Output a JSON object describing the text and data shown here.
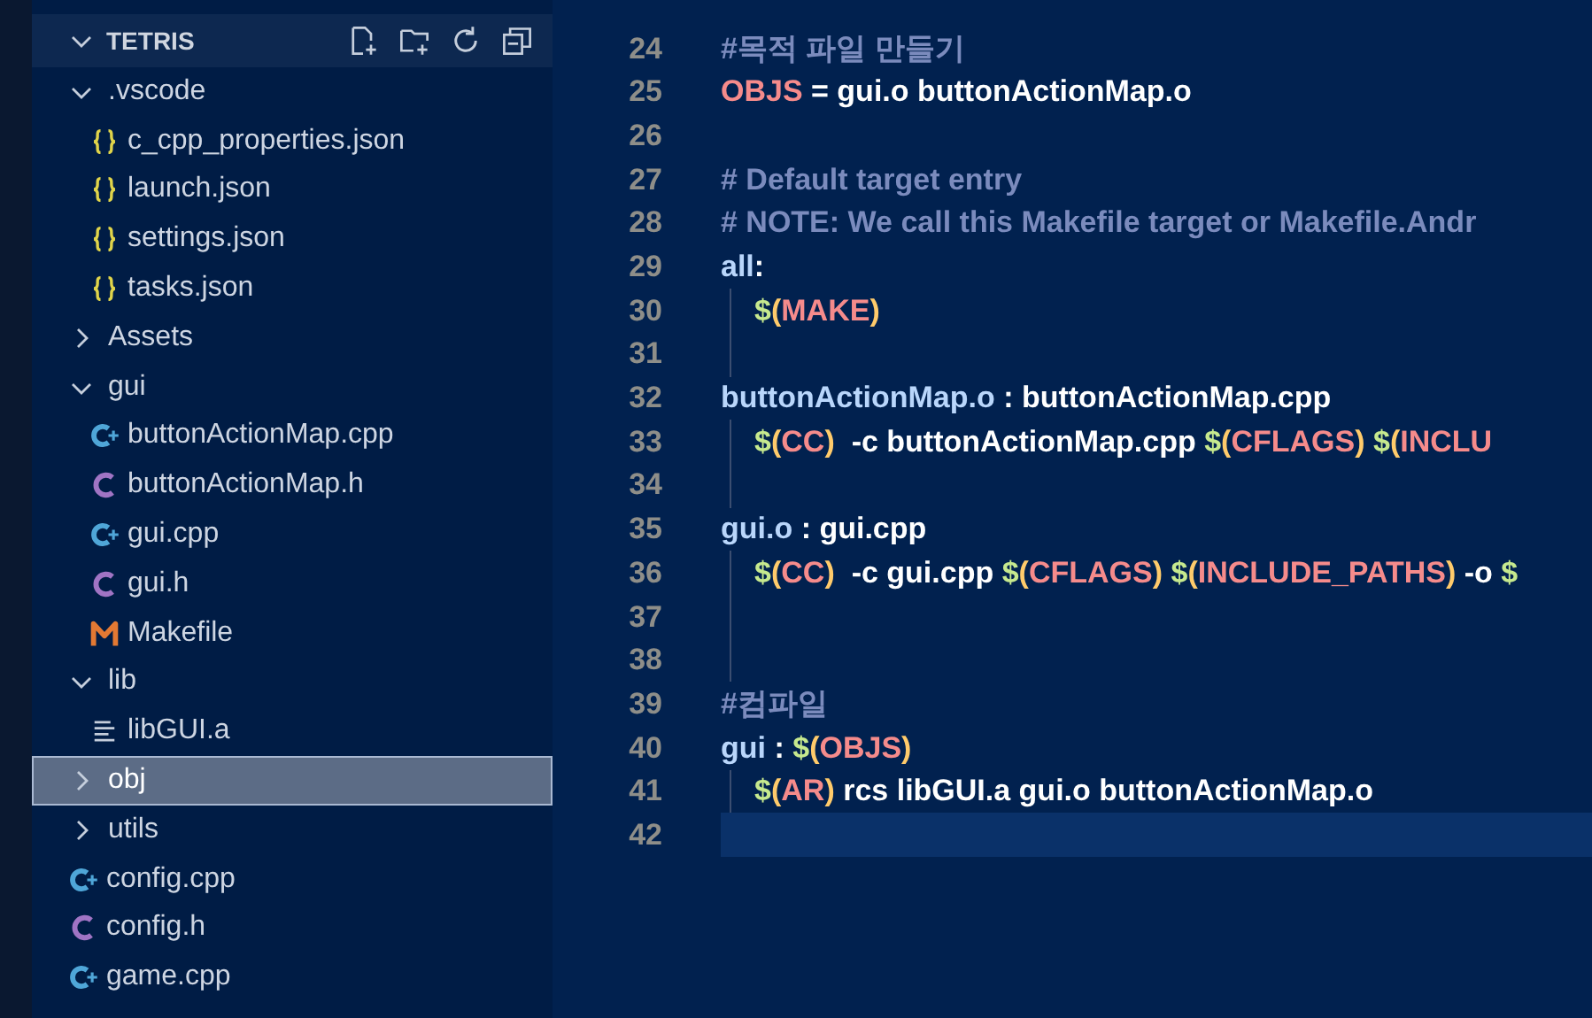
{
  "explorer": {
    "title": "TETRIS",
    "expanded": true,
    "tree": [
      {
        "label": ".vscode",
        "kind": "folder",
        "expanded": true,
        "selected": false,
        "children": [
          {
            "label": "c_cpp_properties.json",
            "kind": "json",
            "selected": false
          },
          {
            "label": "launch.json",
            "kind": "json",
            "selected": false
          },
          {
            "label": "settings.json",
            "kind": "json",
            "selected": false
          },
          {
            "label": "tasks.json",
            "kind": "json",
            "selected": false
          }
        ]
      },
      {
        "label": "Assets",
        "kind": "folder",
        "expanded": false,
        "selected": false
      },
      {
        "label": "gui",
        "kind": "folder",
        "expanded": true,
        "selected": false,
        "children": [
          {
            "label": "buttonActionMap.cpp",
            "kind": "cpp",
            "selected": false
          },
          {
            "label": "buttonActionMap.h",
            "kind": "header",
            "selected": false
          },
          {
            "label": "gui.cpp",
            "kind": "cpp",
            "selected": false
          },
          {
            "label": "gui.h",
            "kind": "header",
            "selected": false
          },
          {
            "label": "Makefile",
            "kind": "makefile",
            "selected": false
          }
        ]
      },
      {
        "label": "lib",
        "kind": "folder",
        "expanded": true,
        "selected": false,
        "children": [
          {
            "label": "libGUI.a",
            "kind": "binary",
            "selected": false
          }
        ]
      },
      {
        "label": "obj",
        "kind": "folder",
        "expanded": false,
        "selected": true
      },
      {
        "label": "utils",
        "kind": "folder",
        "expanded": false,
        "selected": false
      },
      {
        "label": "config.cpp",
        "kind": "cpp",
        "selected": false
      },
      {
        "label": "config.h",
        "kind": "header",
        "selected": false
      },
      {
        "label": "game.cpp",
        "kind": "cpp",
        "selected": false
      }
    ]
  },
  "editor": {
    "lines": [
      {
        "number": "24",
        "indented": false,
        "current": false,
        "tokens": [
          {
            "kind": "comment",
            "text": "#목적 파일 만들기"
          }
        ]
      },
      {
        "number": "25",
        "indented": false,
        "current": false,
        "tokens": [
          {
            "kind": "var",
            "text": "OBJS"
          },
          {
            "kind": "plain",
            "text": " = gui.o buttonActionMap.o"
          }
        ]
      },
      {
        "number": "26",
        "indented": false,
        "current": false
      },
      {
        "number": "27",
        "indented": false,
        "current": false,
        "tokens": [
          {
            "kind": "comment",
            "text": "# Default target entry"
          }
        ]
      },
      {
        "number": "28",
        "indented": false,
        "current": false,
        "tokens": [
          {
            "kind": "comment",
            "text": "# NOTE: We call this Makefile target or Makefile.Andr"
          }
        ]
      },
      {
        "number": "29",
        "indented": false,
        "current": false,
        "tokens": [
          {
            "kind": "target",
            "text": "all"
          },
          {
            "kind": "plain",
            "text": ":"
          }
        ]
      },
      {
        "number": "30",
        "indented": true,
        "current": false,
        "tokens": [
          {
            "kind": "dollar",
            "text": "$"
          },
          {
            "kind": "paren",
            "text": "("
          },
          {
            "kind": "var",
            "text": "MAKE"
          },
          {
            "kind": "paren",
            "text": ")"
          }
        ]
      },
      {
        "number": "31",
        "indented": true,
        "current": false
      },
      {
        "number": "32",
        "indented": false,
        "current": false,
        "tokens": [
          {
            "kind": "target",
            "text": "buttonActionMap.o"
          },
          {
            "kind": "plain",
            "text": " : buttonActionMap.cpp"
          }
        ]
      },
      {
        "number": "33",
        "indented": true,
        "current": false,
        "tokens": [
          {
            "kind": "dollar",
            "text": "$"
          },
          {
            "kind": "paren",
            "text": "("
          },
          {
            "kind": "var",
            "text": "CC"
          },
          {
            "kind": "paren",
            "text": ")"
          },
          {
            "kind": "plain",
            "text": "  -c buttonActionMap.cpp "
          },
          {
            "kind": "dollar",
            "text": "$"
          },
          {
            "kind": "paren",
            "text": "("
          },
          {
            "kind": "var",
            "text": "CFLAGS"
          },
          {
            "kind": "paren",
            "text": ")"
          },
          {
            "kind": "dollar",
            "text": " $"
          },
          {
            "kind": "paren",
            "text": "("
          },
          {
            "kind": "var",
            "text": "INCLU"
          }
        ]
      },
      {
        "number": "34",
        "indented": true,
        "current": false
      },
      {
        "number": "35",
        "indented": false,
        "current": false,
        "tokens": [
          {
            "kind": "target",
            "text": "gui.o"
          },
          {
            "kind": "plain",
            "text": " : gui.cpp"
          }
        ]
      },
      {
        "number": "36",
        "indented": true,
        "current": false,
        "tokens": [
          {
            "kind": "dollar",
            "text": "$"
          },
          {
            "kind": "paren",
            "text": "("
          },
          {
            "kind": "var",
            "text": "CC"
          },
          {
            "kind": "paren",
            "text": ")"
          },
          {
            "kind": "plain",
            "text": "  -c gui.cpp "
          },
          {
            "kind": "dollar",
            "text": "$"
          },
          {
            "kind": "paren",
            "text": "("
          },
          {
            "kind": "var",
            "text": "CFLAGS"
          },
          {
            "kind": "paren",
            "text": ")"
          },
          {
            "kind": "dollar",
            "text": " $"
          },
          {
            "kind": "paren",
            "text": "("
          },
          {
            "kind": "var",
            "text": "INCLUDE_PATHS"
          },
          {
            "kind": "paren",
            "text": ")"
          },
          {
            "kind": "plain",
            "text": " -o "
          },
          {
            "kind": "dollar",
            "text": "$"
          }
        ]
      },
      {
        "number": "37",
        "indented": true,
        "current": false
      },
      {
        "number": "38",
        "indented": true,
        "current": false
      },
      {
        "number": "39",
        "indented": false,
        "current": false,
        "tokens": [
          {
            "kind": "comment",
            "text": "#컴파일"
          }
        ]
      },
      {
        "number": "40",
        "indented": false,
        "current": false,
        "tokens": [
          {
            "kind": "target",
            "text": "gui"
          },
          {
            "kind": "plain",
            "text": " : "
          },
          {
            "kind": "dollar",
            "text": "$"
          },
          {
            "kind": "paren",
            "text": "("
          },
          {
            "kind": "var",
            "text": "OBJS"
          },
          {
            "kind": "paren",
            "text": ")"
          }
        ]
      },
      {
        "number": "41",
        "indented": true,
        "current": false,
        "tokens": [
          {
            "kind": "dollar",
            "text": "$"
          },
          {
            "kind": "paren",
            "text": "("
          },
          {
            "kind": "var",
            "text": "AR"
          },
          {
            "kind": "paren",
            "text": ")"
          },
          {
            "kind": "plain",
            "text": " rcs libGUI.a gui.o buttonActionMap.o"
          }
        ]
      },
      {
        "number": "42",
        "indented": false,
        "current": true
      }
    ]
  }
}
